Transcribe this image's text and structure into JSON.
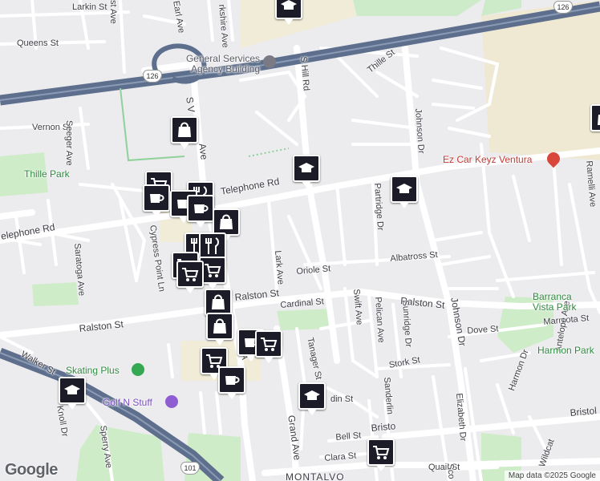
{
  "streets": {
    "larkin": "Larkin St",
    "queens": "Queens St",
    "vernon": "Vernon St",
    "seeger": "Seeger Ave",
    "s_victoria_top": "S V",
    "s_victoria_mid": "Ave",
    "yorkshire": "rkshire Ave",
    "earl": "Earl Ave",
    "st_ave": "st Ave",
    "s_hill": "S Hill Rd",
    "thille": "Thille St",
    "johnson_top": "Johnson Dr",
    "johnson_bottom": "Johnson Dr",
    "telephone_e": "Telephone Rd",
    "telephone_w": "elephone Rd",
    "cypress": "Cypress Point Ln",
    "saratoga": "Saratoga Ave",
    "partridge": "Partridge Dr",
    "albatross": "Albatross St",
    "lark": "Lark Ave",
    "oriole": "Oriole St",
    "ralston_mid": "Ralston St",
    "ralston_w": "Ralston St",
    "ralston_e": "Ralston St",
    "cardinal": "Cardinal St",
    "swift": "Swift Ave",
    "pelican": "Pelican Ave",
    "sunridge": "Sunridge Dr",
    "dove": "Dove St",
    "marmota": "Marmota St",
    "stork": "Stork St",
    "tanager": "Tanager St",
    "walker": "Walker St",
    "knoll": "Knoll Dr",
    "sperry": "Sperry Ave",
    "grand": "Grand Ave",
    "bristol_mid": "Bristo",
    "bristol_e": "Bristol",
    "sanderling": "Sanderlin",
    "elizabeth": "Elizabeth Dr",
    "harmon": "Harmon Dr",
    "antelope": "Antelope Ave",
    "wildcat": "Wildcat",
    "bell": "Bell St",
    "clara": "Clara St",
    "quail": "Quail St",
    "montalvo": "MONTALVO",
    "ramelli": "Ramelli Ave",
    "victoria_frag": "oria A",
    "din": "din St",
    "sco": "Sco"
  },
  "places": {
    "gsa": "General Services Agency Building",
    "ez_car": "Ez Car Keyz Ventura",
    "thille_park": "Thille Park",
    "barranca": "Barranca Vista Park",
    "harmon_park": "Harmon Park",
    "skating": "Skating Plus",
    "golf": "Golf N Stuff"
  },
  "shields": {
    "h126_top": "126",
    "h126_left": "126",
    "h101": "101"
  },
  "markers": [
    {
      "name": "school",
      "icon": "school-icon"
    },
    {
      "name": "shopping-bag",
      "icon": "shopping-bag-icon"
    },
    {
      "name": "school",
      "icon": "school-icon"
    },
    {
      "name": "school",
      "icon": "school-icon"
    },
    {
      "name": "cart",
      "icon": "shopping-cart-icon"
    },
    {
      "name": "cafe",
      "icon": "coffee-cup-icon"
    },
    {
      "name": "restaurant",
      "icon": "fork-knife-icon"
    },
    {
      "name": "shopping-bag",
      "icon": "shopping-bag-icon"
    },
    {
      "name": "cart",
      "icon": "shopping-cart-icon"
    },
    {
      "name": "cafe",
      "icon": "coffee-cup-icon"
    }
  ],
  "colors": {
    "pin_bg": "#1b1c28",
    "park": "#c9eac5",
    "highway": "#5b6f8a",
    "commercial": "#f3edd5"
  },
  "attribution": {
    "logo": "Google",
    "text": "Map data ©2025 Google"
  }
}
